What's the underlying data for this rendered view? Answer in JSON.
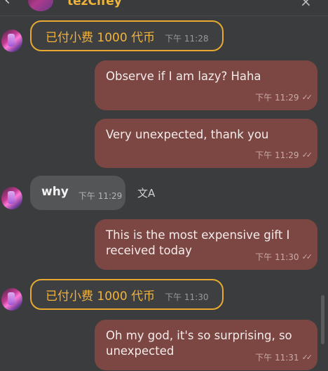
{
  "header": {
    "title": "tezCifey",
    "back_icon": "chevron-left-icon",
    "close_icon": "close-icon"
  },
  "messages": [
    {
      "type": "gift",
      "text": "已付小费 1000 代币",
      "time": "下午 11:28"
    },
    {
      "type": "outgoing",
      "text": "Observe if I am lazy? Haha",
      "time": "下午 11:29"
    },
    {
      "type": "outgoing",
      "text": "Very unexpected, thank you",
      "time": "下午 11:29"
    },
    {
      "type": "incoming",
      "text": "why",
      "time": "下午 11:29"
    },
    {
      "type": "outgoing",
      "text": "This is the most expensive gift I received today",
      "time": "下午 11:30"
    },
    {
      "type": "gift",
      "text": "已付小费 1000 代币",
      "time": "下午 11:30"
    },
    {
      "type": "outgoing",
      "text": "Oh my god, it's so surprising, so unexpected",
      "time": "下午 11:31"
    }
  ],
  "icons": {
    "translate": "文A",
    "read_receipt": "double-check-icon"
  },
  "colors": {
    "gift_border": "#e9a931",
    "gift_text": "#f3b33c",
    "outgoing_bubble": "#7c4743",
    "incoming_bubble": "#545557",
    "background": "#3b3c3e"
  }
}
